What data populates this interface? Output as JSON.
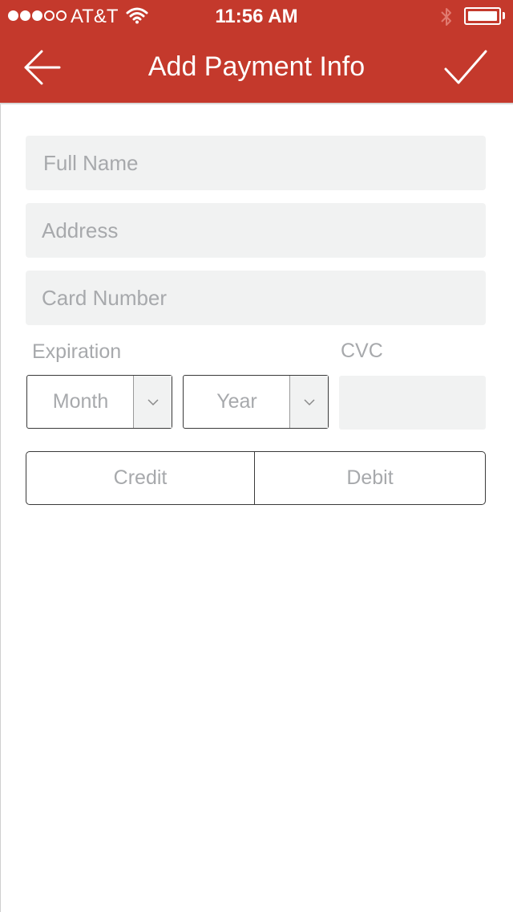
{
  "status_bar": {
    "carrier": "AT&T",
    "time": "11:56 AM",
    "signal_bars_filled": 3,
    "signal_bars_total": 5,
    "icons": [
      "wifi-icon",
      "bluetooth-icon",
      "battery-icon"
    ]
  },
  "header": {
    "title": "Add Payment Info",
    "back_icon": "arrow-left-icon",
    "confirm_icon": "checkmark-icon",
    "color": "#c4392c"
  },
  "form": {
    "full_name": {
      "placeholder": "Full Name",
      "value": ""
    },
    "address": {
      "placeholder": "Address",
      "value": ""
    },
    "card_number": {
      "placeholder": "Card Number",
      "value": ""
    },
    "expiration_label": "Expiration",
    "cvc_label": "CVC",
    "month_select": {
      "value": "Month"
    },
    "year_select": {
      "value": "Year"
    },
    "cvc": {
      "value": ""
    },
    "card_type": {
      "credit_label": "Credit",
      "debit_label": "Debit"
    }
  }
}
